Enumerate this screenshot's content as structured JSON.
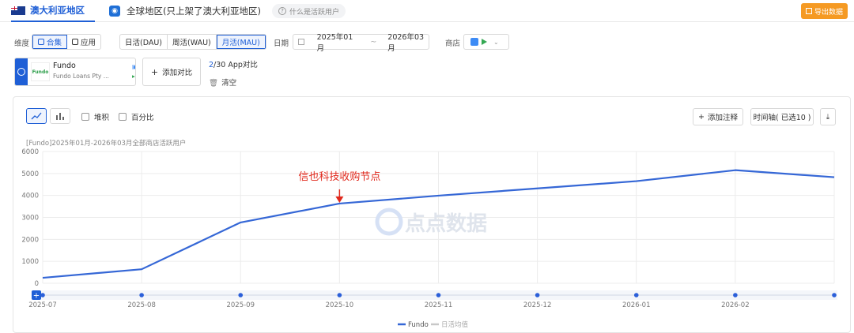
{
  "tabs": {
    "region_active": "澳大利亚地区",
    "region_global": "全球地区(只上架了澳大利亚地区)",
    "help": "什么是活跃用户",
    "export": "导出数据"
  },
  "filters": {
    "dimension_label": "维度",
    "dimension_options": [
      "合集",
      "应用"
    ],
    "dimension_selected": "合集",
    "period_options": [
      "日活(DAU)",
      "周活(WAU)",
      "月活(MAU)"
    ],
    "period_selected": "月活(MAU)",
    "date_label": "日期",
    "date_start": "2025年01月",
    "date_sep": "~",
    "date_end": "2026年03月",
    "store_label": "商店"
  },
  "app": {
    "logo_text": "Fundo",
    "name": "Fundo",
    "developer": "Fundo Loans Pty ...",
    "ios_count": "1",
    "android_count": "1"
  },
  "compare": {
    "add_label": "添加对比",
    "count_used": "2",
    "count_text": "/30 App对比",
    "clear_label": "清空"
  },
  "toolbar": {
    "stack_label": "堆积",
    "percent_label": "百分比",
    "annotate_label": "添加注释",
    "timeline_label": "时间轴( 已选10 )"
  },
  "colors": {
    "accent": "#1f5fd6",
    "line": "#3567d6",
    "annotation": "#e0281c",
    "export": "#f59a23"
  },
  "chart_data": {
    "type": "line",
    "title": "[Fundo]2025年01月-2026年03月全部商店活跃用户",
    "x": [
      "2025-07",
      "2025-08",
      "2025-09",
      "2025-10",
      "2025-11",
      "2025-12",
      "2026-01",
      "2026-02",
      "2026-03"
    ],
    "x_tick_labels": [
      "2025-07",
      "2025-08",
      "2025-09",
      "2025-10",
      "2025-11",
      "2025-12",
      "2026-01",
      "2026-02"
    ],
    "series": [
      {
        "name": "Fundo",
        "values": [
          250,
          640,
          2770,
          3630,
          3990,
          4320,
          4650,
          5150,
          4830
        ]
      }
    ],
    "legend_secondary": "日活均值",
    "ylim": [
      0,
      6000
    ],
    "yticks": [
      0,
      1000,
      2000,
      3000,
      4000,
      5000,
      6000
    ],
    "grid": true,
    "legend_position": "bottom-center",
    "annotation": {
      "text": "信也科技收购节点",
      "x": "2025-10"
    },
    "watermark": "点点数据"
  }
}
